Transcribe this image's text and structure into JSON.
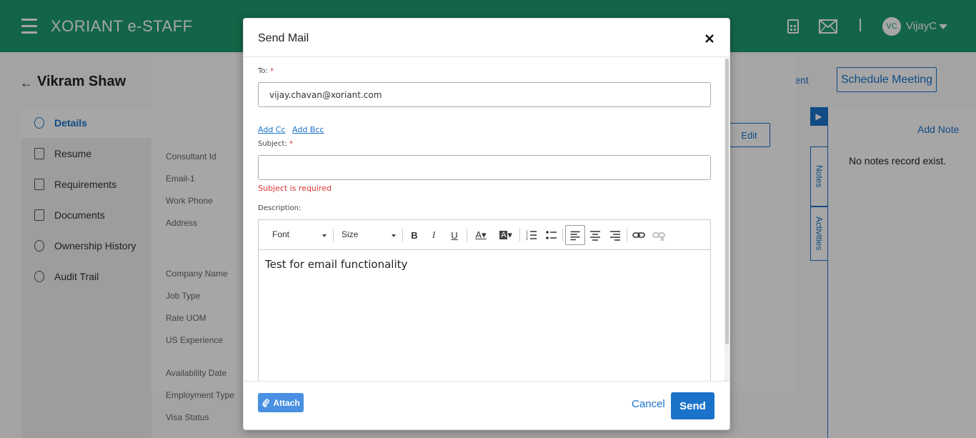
{
  "header": {
    "brand": "XORIANT e-STAFF",
    "user_initials": "VC",
    "user_name": "VijayC"
  },
  "page": {
    "title": "Vikram Shaw",
    "link_requirement": "Link Requirement",
    "schedule_meeting": "Schedule Meeting",
    "edit": "Edit"
  },
  "sidebar": {
    "items": [
      {
        "label": "Details",
        "icon": "person-icon"
      },
      {
        "label": "Resume",
        "icon": "resume-icon"
      },
      {
        "label": "Requirements",
        "icon": "clipboard-icon"
      },
      {
        "label": "Documents",
        "icon": "document-icon"
      },
      {
        "label": "Ownership History",
        "icon": "history-icon"
      },
      {
        "label": "Audit Trail",
        "icon": "history-icon"
      }
    ]
  },
  "details": {
    "labels": [
      "Consultant Id",
      "Email-1",
      "Work Phone",
      "Address",
      "Company Name",
      "Job Type",
      "Rate UOM",
      "US Experience",
      "Availability Date",
      "Employment Type",
      "Visa Status"
    ]
  },
  "right_panel": {
    "tabs": [
      "Notes",
      "Activities"
    ],
    "add_note": "Add Note",
    "empty_text": "No notes record exist."
  },
  "modal": {
    "title": "Send Mail",
    "to_label": "To:",
    "to_value": "vijay.chavan@xoriant.com",
    "add_cc": "Add Cc",
    "add_bcc": "Add Bcc",
    "subject_label": "Subject:",
    "subject_value": "",
    "subject_error": "Subject is required",
    "description_label": "Description:",
    "toolbar": {
      "font": "Font",
      "size": "Size"
    },
    "body_text": "Test for email functionality",
    "attach": "Attach",
    "cancel": "Cancel",
    "send": "Send"
  },
  "colors": {
    "header": "#1e9b6e",
    "accent": "#1a73c9",
    "error": "#dd3333"
  }
}
